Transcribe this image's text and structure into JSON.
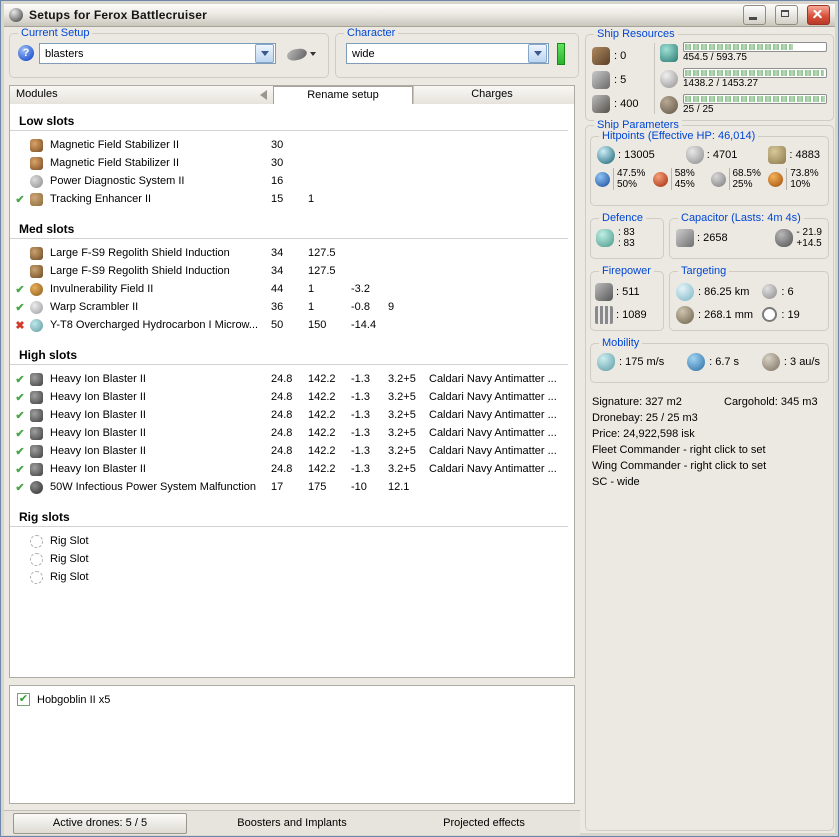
{
  "colors": {
    "label_blue": "#0046d5",
    "bar_green": "#8cc08c",
    "check_green": "#4aa64a",
    "cross_red": "#d23a2a",
    "close_button_red": "#c9452f"
  },
  "window": {
    "title": "Setups for Ferox Battlecruiser",
    "app_icon": "app-icon",
    "controls": [
      "minimize-button",
      "maximize-button",
      "close-button"
    ]
  },
  "setup_bar": {
    "current_setup": {
      "label": "Current Setup",
      "value": "blasters",
      "help_icon": "help-icon",
      "menu_icon": "ship-menu-icon"
    },
    "character": {
      "label": "Character",
      "value": "wide",
      "indicator_icon": "character-skill-indicator"
    }
  },
  "modules_panel": {
    "header_label": "Modules",
    "sort_icon": "sort-arrow-icon",
    "tabs": [
      {
        "label": "Rename setup",
        "active": true
      },
      {
        "label": "Charges",
        "active": false
      }
    ],
    "sections": [
      {
        "title": "Low slots",
        "rows": [
          {
            "status": "",
            "icon": "magnetic-field-stabilizer-icon",
            "name": "Magnetic Field Stabilizer II",
            "c1": "30",
            "c2": "",
            "c3": "",
            "c4": "",
            "charge": ""
          },
          {
            "status": "",
            "icon": "magnetic-field-stabilizer-icon",
            "name": "Magnetic Field Stabilizer II",
            "c1": "30",
            "c2": "",
            "c3": "",
            "c4": "",
            "charge": ""
          },
          {
            "status": "",
            "icon": "power-diagnostic-icon",
            "name": "Power Diagnostic System II",
            "c1": "16",
            "c2": "",
            "c3": "",
            "c4": "",
            "charge": ""
          },
          {
            "status": "check",
            "icon": "tracking-enhancer-icon",
            "name": "Tracking Enhancer II",
            "c1": "15",
            "c2": "1",
            "c3": "",
            "c4": "",
            "charge": ""
          }
        ]
      },
      {
        "title": "Med slots",
        "rows": [
          {
            "status": "",
            "icon": "shield-extender-icon",
            "name": "Large F-S9 Regolith Shield Induction",
            "c1": "34",
            "c2": "127.5",
            "c3": "",
            "c4": "",
            "charge": ""
          },
          {
            "status": "",
            "icon": "shield-extender-icon",
            "name": "Large F-S9 Regolith Shield Induction",
            "c1": "34",
            "c2": "127.5",
            "c3": "",
            "c4": "",
            "charge": ""
          },
          {
            "status": "check",
            "icon": "invulnerability-field-icon",
            "name": "Invulnerability Field II",
            "c1": "44",
            "c2": "1",
            "c3": "-3.2",
            "c4": "",
            "charge": ""
          },
          {
            "status": "check",
            "icon": "warp-scrambler-icon",
            "name": "Warp Scrambler II",
            "c1": "36",
            "c2": "1",
            "c3": "-0.8",
            "c4": "9",
            "charge": ""
          },
          {
            "status": "cross",
            "icon": "afterburner-icon",
            "name": "Y-T8 Overcharged Hydrocarbon I Microw...",
            "c1": "50",
            "c2": "150",
            "c3": "-14.4",
            "c4": "",
            "charge": ""
          }
        ]
      },
      {
        "title": "High slots",
        "rows": [
          {
            "status": "check",
            "icon": "blaster-icon",
            "name": "Heavy Ion Blaster II",
            "c1": "24.8",
            "c2": "142.2",
            "c3": "-1.3",
            "c4": "3.2+5",
            "charge": "Caldari Navy Antimatter ..."
          },
          {
            "status": "check",
            "icon": "blaster-icon",
            "name": "Heavy Ion Blaster II",
            "c1": "24.8",
            "c2": "142.2",
            "c3": "-1.3",
            "c4": "3.2+5",
            "charge": "Caldari Navy Antimatter ..."
          },
          {
            "status": "check",
            "icon": "blaster-icon",
            "name": "Heavy Ion Blaster II",
            "c1": "24.8",
            "c2": "142.2",
            "c3": "-1.3",
            "c4": "3.2+5",
            "charge": "Caldari Navy Antimatter ..."
          },
          {
            "status": "check",
            "icon": "blaster-icon",
            "name": "Heavy Ion Blaster II",
            "c1": "24.8",
            "c2": "142.2",
            "c3": "-1.3",
            "c4": "3.2+5",
            "charge": "Caldari Navy Antimatter ..."
          },
          {
            "status": "check",
            "icon": "blaster-icon",
            "name": "Heavy Ion Blaster II",
            "c1": "24.8",
            "c2": "142.2",
            "c3": "-1.3",
            "c4": "3.2+5",
            "charge": "Caldari Navy Antimatter ..."
          },
          {
            "status": "check",
            "icon": "blaster-icon",
            "name": "Heavy Ion Blaster II",
            "c1": "24.8",
            "c2": "142.2",
            "c3": "-1.3",
            "c4": "3.2+5",
            "charge": "Caldari Navy Antimatter ..."
          },
          {
            "status": "check",
            "icon": "power-malfunction-icon",
            "name": "50W Infectious Power System Malfunction",
            "c1": "17",
            "c2": "175",
            "c3": "-10",
            "c4": "12.1",
            "charge": ""
          }
        ]
      },
      {
        "title": "Rig slots",
        "rows": [
          {
            "status": "",
            "icon": "rig-slot-icon",
            "name": "Rig Slot",
            "c1": "",
            "c2": "",
            "c3": "",
            "c4": "",
            "charge": ""
          },
          {
            "status": "",
            "icon": "rig-slot-icon",
            "name": "Rig Slot",
            "c1": "",
            "c2": "",
            "c3": "",
            "c4": "",
            "charge": ""
          },
          {
            "status": "",
            "icon": "rig-slot-icon",
            "name": "Rig Slot",
            "c1": "",
            "c2": "",
            "c3": "",
            "c4": "",
            "charge": ""
          }
        ]
      }
    ]
  },
  "drones_panel": {
    "items": [
      {
        "checked": true,
        "label": "Hobgoblin II x5"
      }
    ]
  },
  "bottom_bar": {
    "tabs": [
      {
        "label": "Active drones: 5 / 5",
        "style": "button"
      },
      {
        "label": "Boosters and Implants",
        "style": "flat"
      },
      {
        "label": "Projected effects",
        "style": "flat"
      }
    ]
  },
  "ship_resources": {
    "label": "Ship Resources",
    "turrets": {
      "icon": "turret-hardpoint-icon",
      "value": ": 0"
    },
    "launchers": {
      "icon": "launcher-hardpoint-icon",
      "value": ": 5"
    },
    "calibration": {
      "icon": "rig-calibration-icon",
      "value": ": 400"
    },
    "bars": [
      {
        "icon": "cpu-icon",
        "text": "454.5 / 593.75",
        "pct": 77
      },
      {
        "icon": "powergrid-icon",
        "text": "1438.2 / 1453.27",
        "pct": 99
      },
      {
        "icon": "drone-bandwidth-icon",
        "text": "25 / 25",
        "pct": 100
      }
    ]
  },
  "ship_parameters": {
    "label": "Ship Parameters",
    "hitpoints": {
      "label": "Hitpoints (Effective HP: 46,014)",
      "shield_icon": "shield-hp-icon",
      "shield": ": 13005",
      "armor_icon": "armor-hp-icon",
      "armor": ": 4701",
      "structure_icon": "structure-hp-icon",
      "structure": ": 4883",
      "resists": [
        {
          "icon": "em-resist-icon",
          "top": "47.5%",
          "bottom": "50%"
        },
        {
          "icon": "thermal-resist-icon",
          "top": "58%",
          "bottom": "45%"
        },
        {
          "icon": "kinetic-resist-icon",
          "top": "68.5%",
          "bottom": "25%"
        },
        {
          "icon": "explosive-resist-icon",
          "top": "73.8%",
          "bottom": "10%"
        }
      ]
    },
    "defence": {
      "label": "Defence",
      "icon": "defence-icon",
      "line1": ": 83",
      "line2": ": 83"
    },
    "capacitor": {
      "label": "Capacitor (Lasts: 4m 4s)",
      "icon": "capacitor-icon",
      "amount": ": 2658",
      "recharge_icon": "cap-recharge-icon",
      "delta_top": "- 21.9",
      "delta_bottom": "+14.5"
    },
    "firepower": {
      "label": "Firepower",
      "dps_icon": "turret-dps-icon",
      "dps": ": 511",
      "volley_icon": "volley-icon",
      "volley": ": 1089"
    },
    "targeting": {
      "label": "Targeting",
      "range_icon": "targeting-range-icon",
      "range": ": 86.25 km",
      "max_targets_icon": "max-targets-icon",
      "max_targets": ": 6",
      "scan_res_icon": "scan-resolution-icon",
      "scan_res": ": 268.1 mm",
      "sensor_icon": "sensor-strength-icon",
      "sensor": ": 19"
    },
    "mobility": {
      "label": "Mobility",
      "speed_icon": "speed-icon",
      "speed": ": 175 m/s",
      "align_icon": "align-time-icon",
      "align": ": 6.7 s",
      "warp_icon": "warp-speed-icon",
      "warp": ": 3 au/s"
    },
    "sig_cargo": {
      "left": "Signature: 327 m2",
      "right": "Cargohold: 345 m3"
    },
    "info_lines": [
      "Dronebay: 25 / 25 m3",
      "Price: 24,922,598 isk",
      "Fleet Commander - right click to set",
      "Wing Commander - right click to set",
      "SC - wide"
    ]
  }
}
